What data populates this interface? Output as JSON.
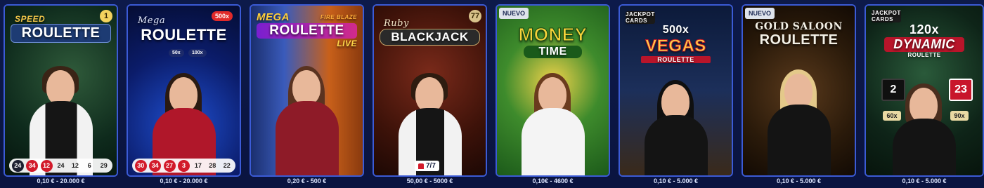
{
  "cards": [
    {
      "name": "speed-roulette",
      "logo_small": "SPEED",
      "logo_big": "ROULETTE",
      "corner_badge": "1",
      "results": [
        {
          "n": "24",
          "c": "black"
        },
        {
          "n": "34",
          "c": "red"
        },
        {
          "n": "12",
          "c": "red"
        },
        {
          "n": "24",
          "c": "plain"
        },
        {
          "n": "12",
          "c": "plain"
        },
        {
          "n": "6",
          "c": "plain"
        },
        {
          "n": "29",
          "c": "plain"
        }
      ],
      "price": "0,10 € - 20.000 €"
    },
    {
      "name": "mega-roulette",
      "logo_small": "Mega",
      "logo_big": "ROULETTE",
      "pill": "500x",
      "pill2": "50x",
      "pill3": "100x",
      "results": [
        {
          "n": "30",
          "c": "red"
        },
        {
          "n": "34",
          "c": "red"
        },
        {
          "n": "27",
          "c": "red"
        },
        {
          "n": "3",
          "c": "red"
        },
        {
          "n": "17",
          "c": "plain"
        },
        {
          "n": "28",
          "c": "plain"
        },
        {
          "n": "22",
          "c": "plain"
        }
      ],
      "price": "0,10 € - 20.000 €"
    },
    {
      "name": "mega-fire-blaze-roulette-live",
      "logo_small": "MEGA",
      "logo_fire": "FIRE BLAZE",
      "logo_big": "ROULETTE",
      "logo_live": "LIVE",
      "price": "0,20 € - 500 €"
    },
    {
      "name": "ruby-blackjack",
      "logo_small": "Ruby",
      "logo_big": "BLACKJACK",
      "corner_badge": "77",
      "seats": "7/7",
      "price": "50,00 € - 5000 €"
    },
    {
      "name": "money-time",
      "badge_new": "NUEVO",
      "logo_big": "MONEY",
      "logo_sub": "TIME",
      "price": "0,10€ - 4600 €"
    },
    {
      "name": "500x-vegas-roulette",
      "logo_jackpot": "JACKPOT CARDS",
      "logo_small": "500x",
      "logo_big": "VEGAS",
      "logo_sub": "ROULETTE",
      "price": "0,10 € - 5.000 €"
    },
    {
      "name": "gold-saloon-roulette",
      "badge_new": "NUEVO",
      "logo_small": "GOLD SALOON",
      "logo_big": "ROULETTE",
      "price": "0,10 € - 5.000 €"
    },
    {
      "name": "120x-dynamic-roulette",
      "logo_jackpot": "JACKPOT CARDS",
      "logo_small": "120x",
      "logo_big": "DYNAMIC",
      "logo_sub": "ROULETTE",
      "box1": "2",
      "box2": "23",
      "mult1": "60x",
      "mult2": "90x",
      "price": "0,10 € - 5.000 €"
    }
  ]
}
